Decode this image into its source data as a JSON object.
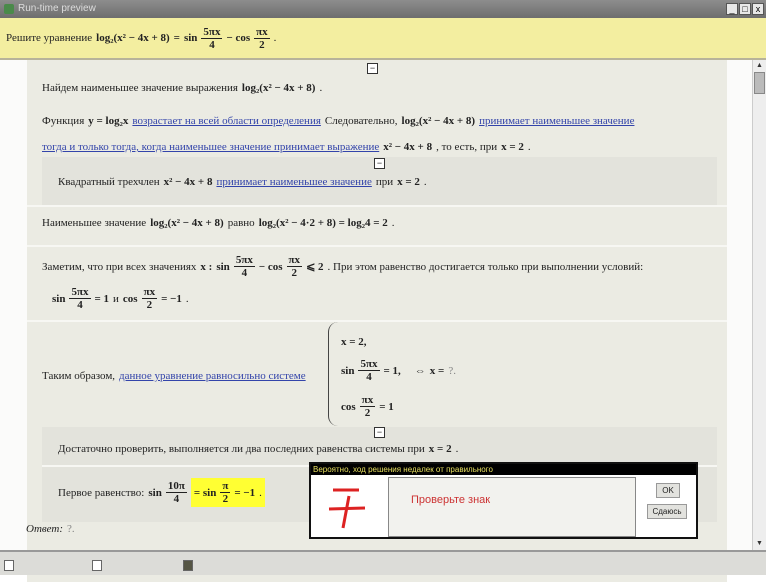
{
  "window": {
    "title": "Run-time preview",
    "min": "_",
    "max": "□",
    "close": "x"
  },
  "task": {
    "label": "Решите уравнение",
    "lhs": "log₂(x² − 4x + 8)",
    "eq": "=",
    "sin": "sin",
    "f1n": "5πx",
    "f1d": "4",
    "minus": "− cos",
    "f2n": "πx",
    "f2d": "2",
    "end": "."
  },
  "solution": {
    "collapse": "−",
    "s1": {
      "text": "Найдем наименьшее значение выражения",
      "math": "log₂(x² − 4x + 8)",
      "end": "."
    },
    "s2": {
      "t1": "Функция",
      "m1": "y = log₂x",
      "link1": "возрастает на всей области определения",
      "t2": "Следовательно,",
      "m2": "log₂(x² − 4x + 8)",
      "link2": "принимает наименьшее значение",
      "link3": "тогда и только тогда, когда наименьшее значение принимает выражение",
      "m3": "x² − 4x + 8",
      "t3": ", то есть, при",
      "m4": "x = 2",
      "end": "."
    },
    "s3": {
      "t1": "Квадратный трехчлен",
      "m1": "x² − 4x + 8",
      "link": "принимает наименьшее значение",
      "t2": "при",
      "m2": "x = 2",
      "end": "."
    },
    "s4": {
      "t1": "Наименьшее значение",
      "m1": "log₂(x² − 4x + 8)",
      "t2": "равно",
      "m2": "log₂(x² − 4·2 + 8)  = log₂4 = 2",
      "end": "."
    },
    "s5": {
      "t1": "Заметим, что при всех значениях",
      "m1": "x :",
      "sin": "sin",
      "f1n": "5πx",
      "f1d": "4",
      "cos": "− cos",
      "f2n": "πx",
      "f2d": "2",
      "le": "⩽ 2",
      "t2": ". При этом равенство достигается только при выполнении условий:",
      "c1sin": "sin",
      "c1r": "= 1",
      "and": "и",
      "c2cos": "cos",
      "c2r": "= −1",
      "end": "."
    },
    "s6": {
      "t1": "Таким образом,",
      "link": "данное уравнение равносильно системе",
      "r1": "x = 2,",
      "r2sin": "sin",
      "r2n": "5πx",
      "r2d": "4",
      "r2r": "= 1,",
      "r3cos": "cos",
      "r3n": "πx",
      "r3d": "2",
      "r3r": "= 1",
      "equiv": "⇔",
      "ans": "x =",
      "q": "?."
    },
    "s7": {
      "t1": "Достаточно проверить, выполняется ли два последних равенства системы при",
      "m1": "x = 2",
      "end": "."
    },
    "s8": {
      "t1": "Первое равенство:",
      "sin": "sin",
      "fn": "10π",
      "fd": "4",
      "hl1": "= sin",
      "hn": "π",
      "hd": "2",
      "hl2": "= −1",
      "end": "."
    },
    "answer": {
      "label": "Ответ:",
      "value": "?."
    }
  },
  "popup": {
    "title": "Вероятно, ход решения недалек от правильного",
    "message": "Проверьте знак",
    "ok": "OK",
    "giveup": "Сдаюсь",
    "icon": "minus-plus-icon"
  }
}
